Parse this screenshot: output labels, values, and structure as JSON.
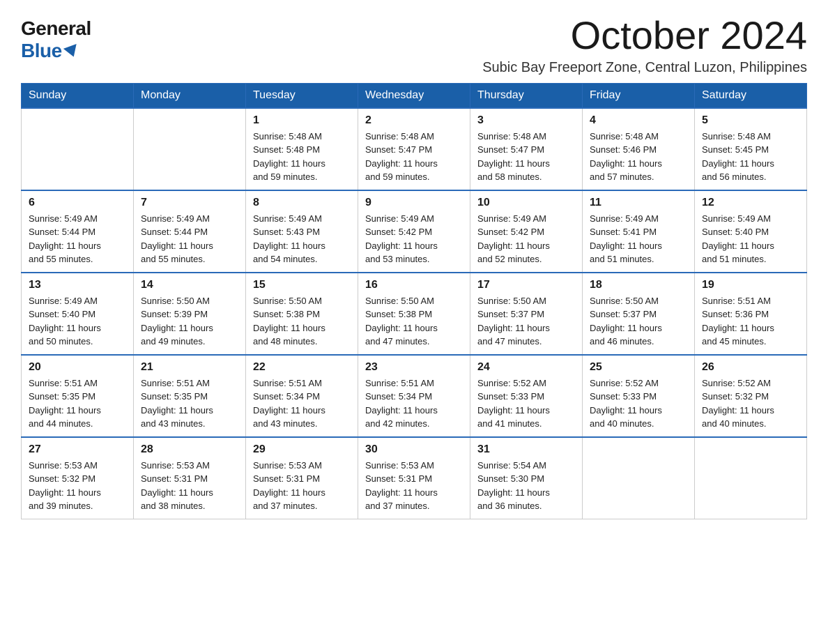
{
  "logo": {
    "general": "General",
    "blue": "Blue"
  },
  "title": "October 2024",
  "subtitle": "Subic Bay Freeport Zone, Central Luzon, Philippines",
  "days_of_week": [
    "Sunday",
    "Monday",
    "Tuesday",
    "Wednesday",
    "Thursday",
    "Friday",
    "Saturday"
  ],
  "weeks": [
    [
      {
        "day": "",
        "info": ""
      },
      {
        "day": "",
        "info": ""
      },
      {
        "day": "1",
        "info": "Sunrise: 5:48 AM\nSunset: 5:48 PM\nDaylight: 11 hours\nand 59 minutes."
      },
      {
        "day": "2",
        "info": "Sunrise: 5:48 AM\nSunset: 5:47 PM\nDaylight: 11 hours\nand 59 minutes."
      },
      {
        "day": "3",
        "info": "Sunrise: 5:48 AM\nSunset: 5:47 PM\nDaylight: 11 hours\nand 58 minutes."
      },
      {
        "day": "4",
        "info": "Sunrise: 5:48 AM\nSunset: 5:46 PM\nDaylight: 11 hours\nand 57 minutes."
      },
      {
        "day": "5",
        "info": "Sunrise: 5:48 AM\nSunset: 5:45 PM\nDaylight: 11 hours\nand 56 minutes."
      }
    ],
    [
      {
        "day": "6",
        "info": "Sunrise: 5:49 AM\nSunset: 5:44 PM\nDaylight: 11 hours\nand 55 minutes."
      },
      {
        "day": "7",
        "info": "Sunrise: 5:49 AM\nSunset: 5:44 PM\nDaylight: 11 hours\nand 55 minutes."
      },
      {
        "day": "8",
        "info": "Sunrise: 5:49 AM\nSunset: 5:43 PM\nDaylight: 11 hours\nand 54 minutes."
      },
      {
        "day": "9",
        "info": "Sunrise: 5:49 AM\nSunset: 5:42 PM\nDaylight: 11 hours\nand 53 minutes."
      },
      {
        "day": "10",
        "info": "Sunrise: 5:49 AM\nSunset: 5:42 PM\nDaylight: 11 hours\nand 52 minutes."
      },
      {
        "day": "11",
        "info": "Sunrise: 5:49 AM\nSunset: 5:41 PM\nDaylight: 11 hours\nand 51 minutes."
      },
      {
        "day": "12",
        "info": "Sunrise: 5:49 AM\nSunset: 5:40 PM\nDaylight: 11 hours\nand 51 minutes."
      }
    ],
    [
      {
        "day": "13",
        "info": "Sunrise: 5:49 AM\nSunset: 5:40 PM\nDaylight: 11 hours\nand 50 minutes."
      },
      {
        "day": "14",
        "info": "Sunrise: 5:50 AM\nSunset: 5:39 PM\nDaylight: 11 hours\nand 49 minutes."
      },
      {
        "day": "15",
        "info": "Sunrise: 5:50 AM\nSunset: 5:38 PM\nDaylight: 11 hours\nand 48 minutes."
      },
      {
        "day": "16",
        "info": "Sunrise: 5:50 AM\nSunset: 5:38 PM\nDaylight: 11 hours\nand 47 minutes."
      },
      {
        "day": "17",
        "info": "Sunrise: 5:50 AM\nSunset: 5:37 PM\nDaylight: 11 hours\nand 47 minutes."
      },
      {
        "day": "18",
        "info": "Sunrise: 5:50 AM\nSunset: 5:37 PM\nDaylight: 11 hours\nand 46 minutes."
      },
      {
        "day": "19",
        "info": "Sunrise: 5:51 AM\nSunset: 5:36 PM\nDaylight: 11 hours\nand 45 minutes."
      }
    ],
    [
      {
        "day": "20",
        "info": "Sunrise: 5:51 AM\nSunset: 5:35 PM\nDaylight: 11 hours\nand 44 minutes."
      },
      {
        "day": "21",
        "info": "Sunrise: 5:51 AM\nSunset: 5:35 PM\nDaylight: 11 hours\nand 43 minutes."
      },
      {
        "day": "22",
        "info": "Sunrise: 5:51 AM\nSunset: 5:34 PM\nDaylight: 11 hours\nand 43 minutes."
      },
      {
        "day": "23",
        "info": "Sunrise: 5:51 AM\nSunset: 5:34 PM\nDaylight: 11 hours\nand 42 minutes."
      },
      {
        "day": "24",
        "info": "Sunrise: 5:52 AM\nSunset: 5:33 PM\nDaylight: 11 hours\nand 41 minutes."
      },
      {
        "day": "25",
        "info": "Sunrise: 5:52 AM\nSunset: 5:33 PM\nDaylight: 11 hours\nand 40 minutes."
      },
      {
        "day": "26",
        "info": "Sunrise: 5:52 AM\nSunset: 5:32 PM\nDaylight: 11 hours\nand 40 minutes."
      }
    ],
    [
      {
        "day": "27",
        "info": "Sunrise: 5:53 AM\nSunset: 5:32 PM\nDaylight: 11 hours\nand 39 minutes."
      },
      {
        "day": "28",
        "info": "Sunrise: 5:53 AM\nSunset: 5:31 PM\nDaylight: 11 hours\nand 38 minutes."
      },
      {
        "day": "29",
        "info": "Sunrise: 5:53 AM\nSunset: 5:31 PM\nDaylight: 11 hours\nand 37 minutes."
      },
      {
        "day": "30",
        "info": "Sunrise: 5:53 AM\nSunset: 5:31 PM\nDaylight: 11 hours\nand 37 minutes."
      },
      {
        "day": "31",
        "info": "Sunrise: 5:54 AM\nSunset: 5:30 PM\nDaylight: 11 hours\nand 36 minutes."
      },
      {
        "day": "",
        "info": ""
      },
      {
        "day": "",
        "info": ""
      }
    ]
  ]
}
